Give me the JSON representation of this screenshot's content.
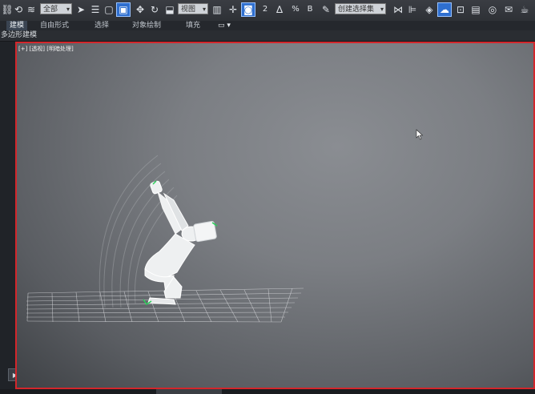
{
  "toolbar": {
    "selection_filter": "全部",
    "reference_coord": "视图",
    "named_selection": "创建选择集"
  },
  "ribbon": {
    "tabs": [
      "建模",
      "自由形式",
      "选择",
      "对象绘制",
      "填充"
    ]
  },
  "subbar": {
    "label": "多边形建模"
  },
  "viewport": {
    "label": "[+] [透视] [明暗处理]",
    "active_border_color": "#d3262b"
  },
  "colors": {
    "accent": "#2f6fcf"
  }
}
